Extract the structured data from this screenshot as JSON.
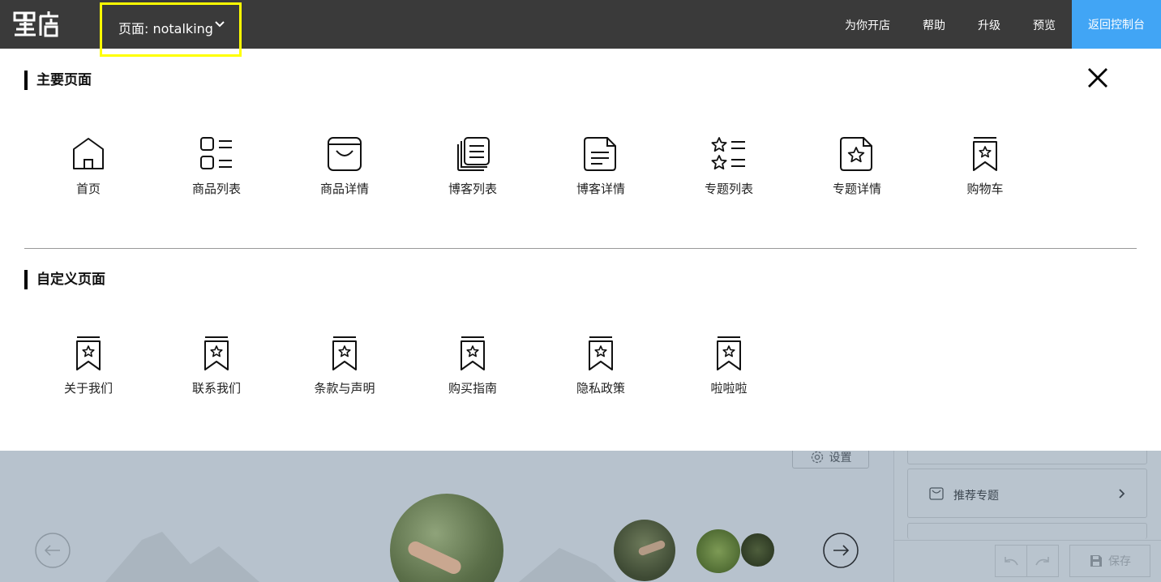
{
  "topbar": {
    "logo_text": "喔店",
    "page_selector_label": "页面: notalking",
    "nav": [
      "为你开店",
      "帮助",
      "升级",
      "预览"
    ],
    "dashboard_label": "返回控制台",
    "dashboard_color": "#41a5f5",
    "highlight_color": "#ffff00"
  },
  "panel": {
    "main_section_title": "主要页面",
    "custom_section_title": "自定义页面",
    "main_pages": [
      {
        "label": "首页",
        "icon": "home-icon"
      },
      {
        "label": "商品列表",
        "icon": "product-list-icon"
      },
      {
        "label": "商品详情",
        "icon": "product-detail-icon"
      },
      {
        "label": "博客列表",
        "icon": "blog-list-icon"
      },
      {
        "label": "博客详情",
        "icon": "blog-detail-icon"
      },
      {
        "label": "专题列表",
        "icon": "topic-list-icon"
      },
      {
        "label": "专题详情",
        "icon": "topic-detail-icon"
      },
      {
        "label": "购物车",
        "icon": "bookmark-star-icon"
      }
    ],
    "custom_pages": [
      {
        "label": "关于我们",
        "icon": "bookmark-star-icon"
      },
      {
        "label": "联系我们",
        "icon": "bookmark-star-icon"
      },
      {
        "label": "条款与声明",
        "icon": "bookmark-star-icon"
      },
      {
        "label": "购买指南",
        "icon": "bookmark-star-icon"
      },
      {
        "label": "隐私政策",
        "icon": "bookmark-star-icon"
      },
      {
        "label": "啦啦啦",
        "icon": "bookmark-star-icon"
      }
    ]
  },
  "editor": {
    "settings_label": "设置",
    "side_items": [
      {
        "label": "推荐专题",
        "icon": "bag-icon"
      }
    ],
    "save_label": "保存"
  }
}
